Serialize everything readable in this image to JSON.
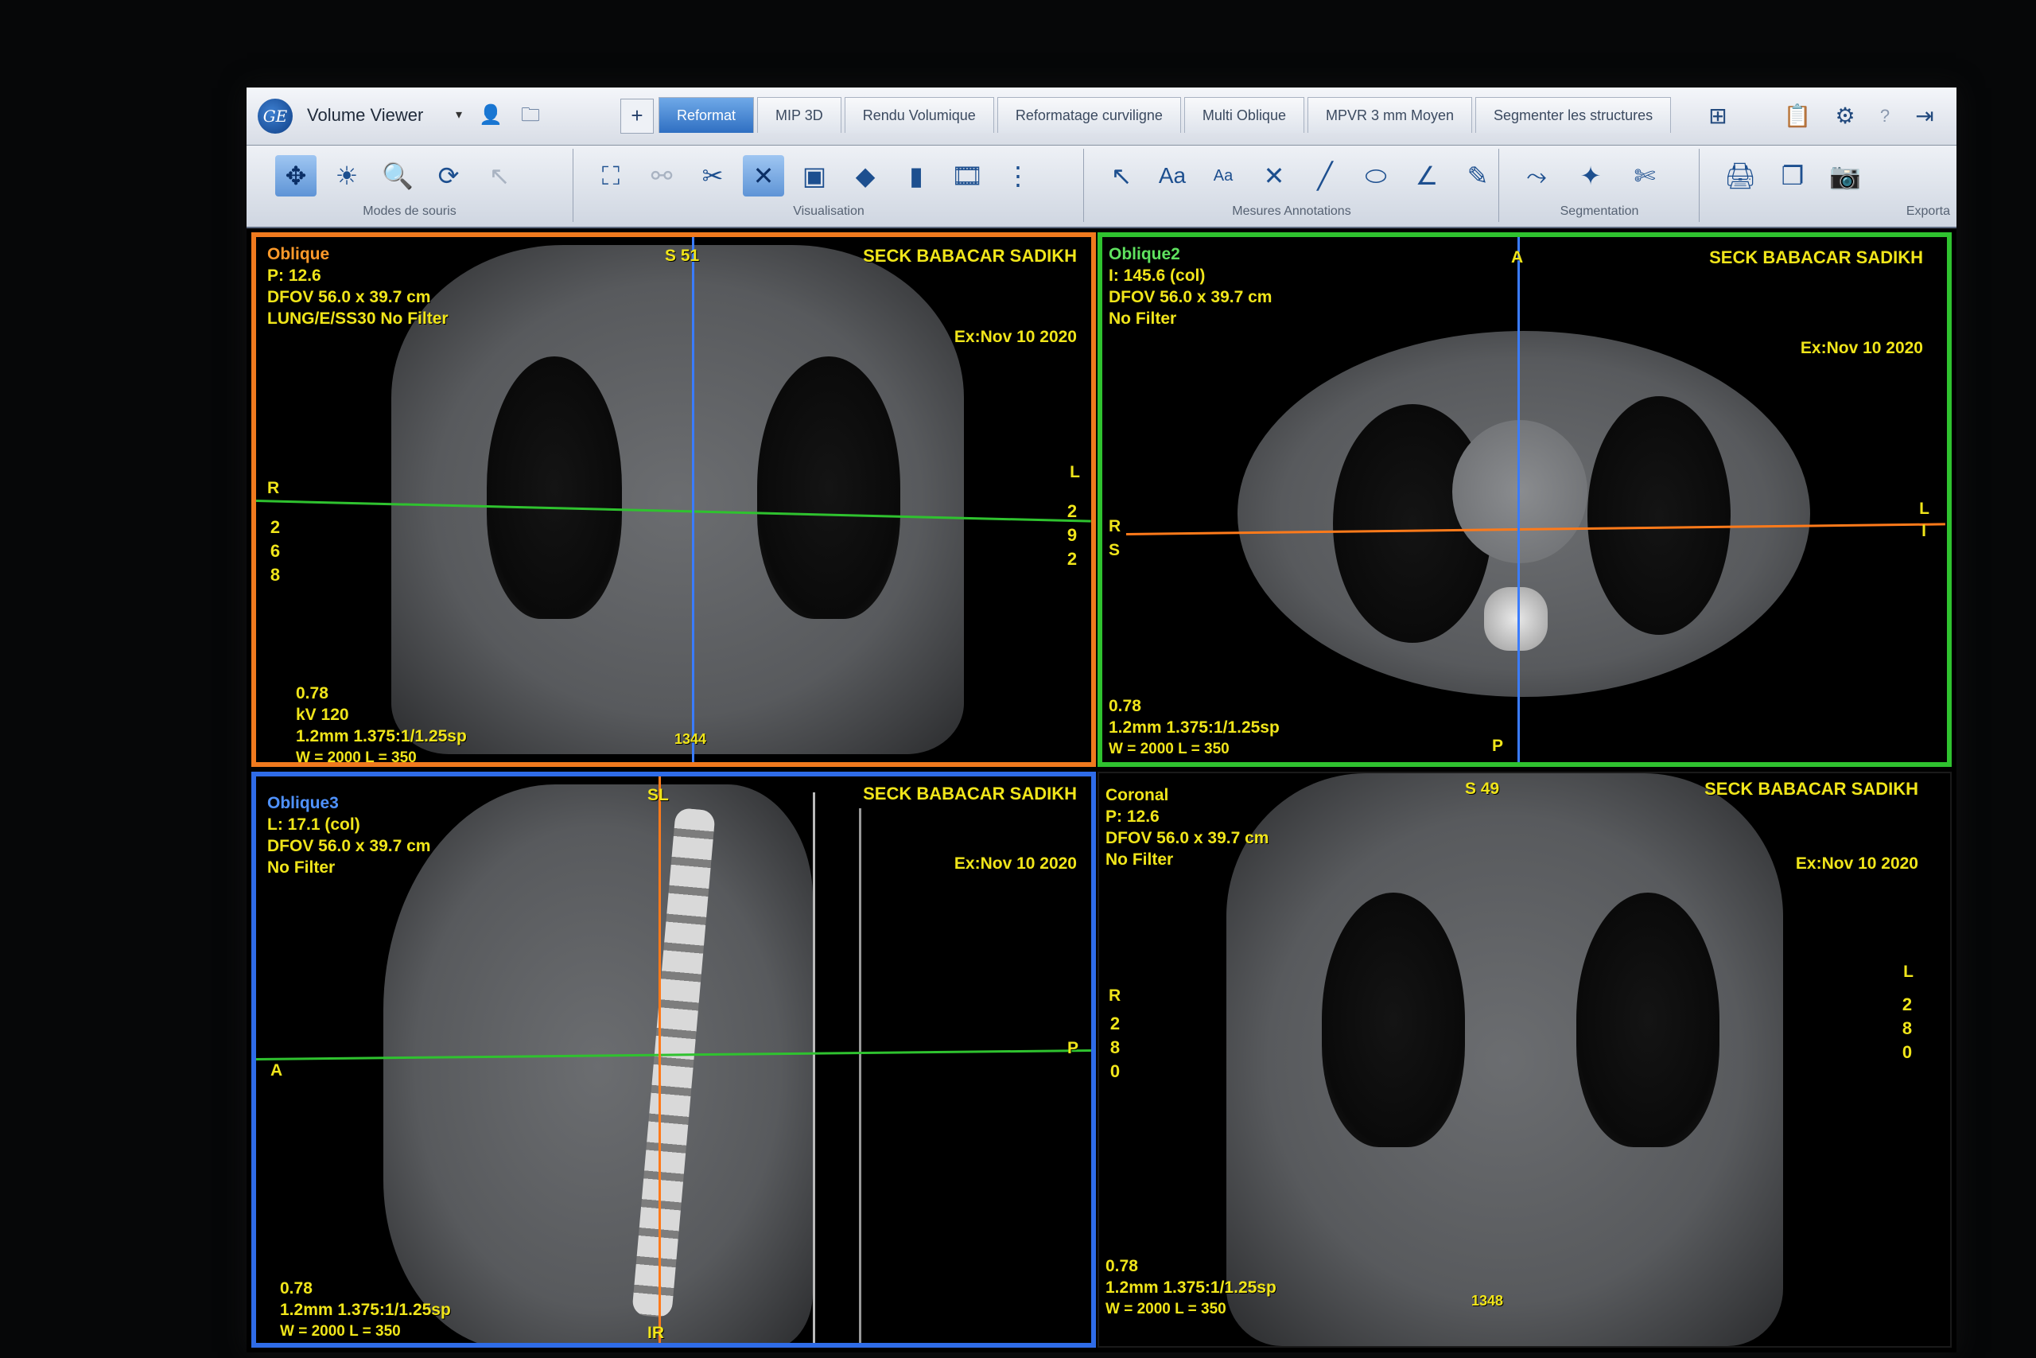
{
  "app": {
    "title": "Volume Viewer",
    "logo_text": "GE"
  },
  "tabs": [
    {
      "label": "Reformat",
      "active": true
    },
    {
      "label": "MIP 3D",
      "active": false
    },
    {
      "label": "Rendu Volumique",
      "active": false
    },
    {
      "label": "Reformatage curviligne",
      "active": false
    },
    {
      "label": "Multi Oblique",
      "active": false
    },
    {
      "label": "MPVR 3 mm Moyen",
      "active": false
    },
    {
      "label": "Segmenter les structures",
      "active": false
    }
  ],
  "add_tab_label": "+",
  "toolbar": {
    "group_mouse": "Modes de souris",
    "group_view": "Visualisation",
    "group_measure": "Mesures  Annotations",
    "group_segment": "Segmentation",
    "group_export": "Exporta",
    "text_tool_1": "Aa",
    "text_tool_2": "Aa"
  },
  "viewports": {
    "v1": {
      "title": "Oblique",
      "line1": "P: 12.6",
      "line2": "DFOV 56.0 x 39.7 cm",
      "line3": "LUNG/E/SS30 No Filter",
      "patient": "SECK BABACAR SADIKH",
      "exam": "Ex:Nov 10 2020",
      "top_marker": "S 51",
      "left_marker": "R",
      "right_marker": "L",
      "left_digits": "2\n6\n8",
      "right_digits": "2\n9\n2",
      "bottom1": "0.78",
      "bottom2": "kV 120",
      "bottom3": "1.2mm 1.375:1/1.25sp",
      "bottom4": "W = 2000 L = 350",
      "bottom_num": "1344"
    },
    "v2": {
      "title": "Oblique2",
      "line1": "I: 145.6 (col)",
      "line2": "DFOV 56.0 x 39.7 cm",
      "line3": "No Filter",
      "patient": "SECK BABACAR SADIKH",
      "exam": "Ex:Nov 10 2020",
      "top_marker": "A",
      "left_marker": "R",
      "left_marker2": "S",
      "right_marker": "L",
      "right_marker2": "I",
      "bottom_marker": "P",
      "bottom1": "0.78",
      "bottom2": "1.2mm 1.375:1/1.25sp",
      "bottom3": "W = 2000 L = 350"
    },
    "v3": {
      "title": "Oblique3",
      "line1": "L: 17.1 (col)",
      "line2": "DFOV 56.0 x 39.7 cm",
      "line3": "No Filter",
      "patient": "SECK BABACAR SADIKH",
      "exam": "Ex:Nov 10 2020",
      "top_marker": "SL",
      "left_marker": "A",
      "right_marker": "P",
      "bottom_marker": "IR",
      "bottom1": "0.78",
      "bottom2": "1.2mm 1.375:1/1.25sp",
      "bottom3": "W = 2000 L = 350"
    },
    "v4": {
      "title": "Coronal",
      "line1": "P: 12.6",
      "line2": "DFOV 56.0 x 39.7 cm",
      "line3": "No Filter",
      "patient": "SECK BABACAR SADIKH",
      "exam": "Ex:Nov 10 2020",
      "top_marker": "S 49",
      "left_marker": "R",
      "right_marker": "L",
      "left_digits": "2\n8\n0",
      "right_digits": "2\n8\n0",
      "bottom1": "0.78",
      "bottom2": "1.2mm 1.375:1/1.25sp",
      "bottom3": "W = 2000 L = 350",
      "bottom_num": "1348"
    }
  },
  "colors": {
    "vp1_border": "#f07a1e",
    "vp2_border": "#2fc22f",
    "vp3_border": "#2f6ce8",
    "overlay_text": "#f0e51a",
    "active_tab": "#2f6fc2"
  }
}
